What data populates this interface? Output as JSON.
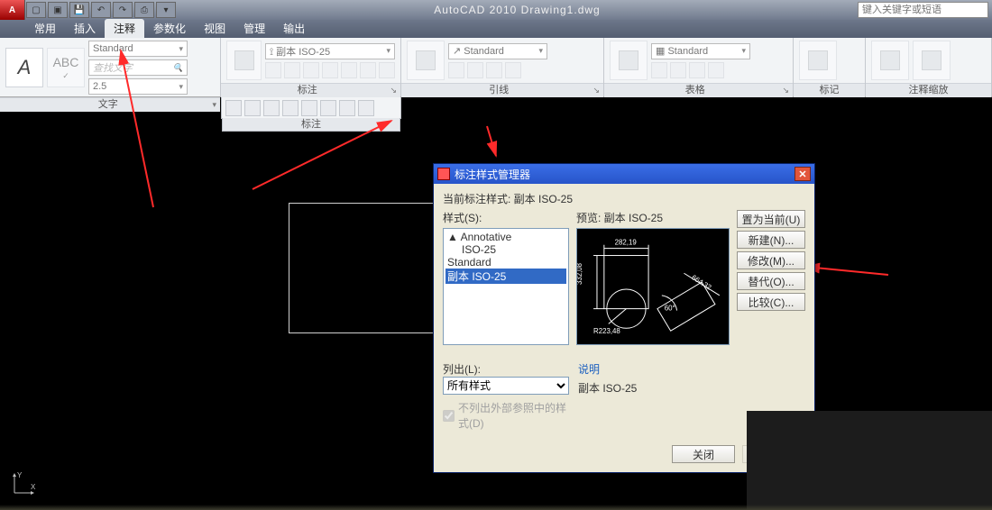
{
  "app": {
    "title": "AutoCAD 2010  Drawing1.dwg",
    "search_placeholder": "键入关键字或短语"
  },
  "tabs": {
    "items": [
      "常用",
      "插入",
      "注释",
      "参数化",
      "视图",
      "管理",
      "输出"
    ],
    "activeIndex": 2
  },
  "ribbon": {
    "panels": [
      {
        "title": "文字",
        "dropdown": "Standard"
      },
      {
        "title": "标注",
        "dropdown": "副本 ISO-25"
      },
      {
        "title": "引线",
        "dropdown": "Standard"
      },
      {
        "title": "表格",
        "dropdown": "Standard"
      },
      {
        "title": "标记",
        "dropdown": ""
      },
      {
        "title": "注释缩放",
        "dropdown": ""
      }
    ],
    "bigA": "A"
  },
  "dialog": {
    "title": "标注样式管理器",
    "current_label": "当前标注样式: 副本 ISO-25",
    "styles_label": "样式(S):",
    "styles": [
      "Annotative",
      "ISO-25",
      "Standard",
      "副本 ISO-25"
    ],
    "selectedIndex": 3,
    "preview_label": "预览: 副本 ISO-25",
    "preview_dims": {
      "top": "282,19",
      "left": "332,08",
      "radius": "R223,48",
      "angle": "60°",
      "diag": "664,32"
    },
    "buttons": {
      "set_current": "置为当前(U)",
      "new": "新建(N)...",
      "modify": "修改(M)...",
      "override": "替代(O)...",
      "compare": "比较(C)..."
    },
    "list_label": "列出(L):",
    "list_value": "所有样式",
    "chk_label": "不列出外部参照中的样式(D)",
    "desc_label": "说明",
    "desc_value": "副本 ISO-25",
    "close": "关闭"
  }
}
